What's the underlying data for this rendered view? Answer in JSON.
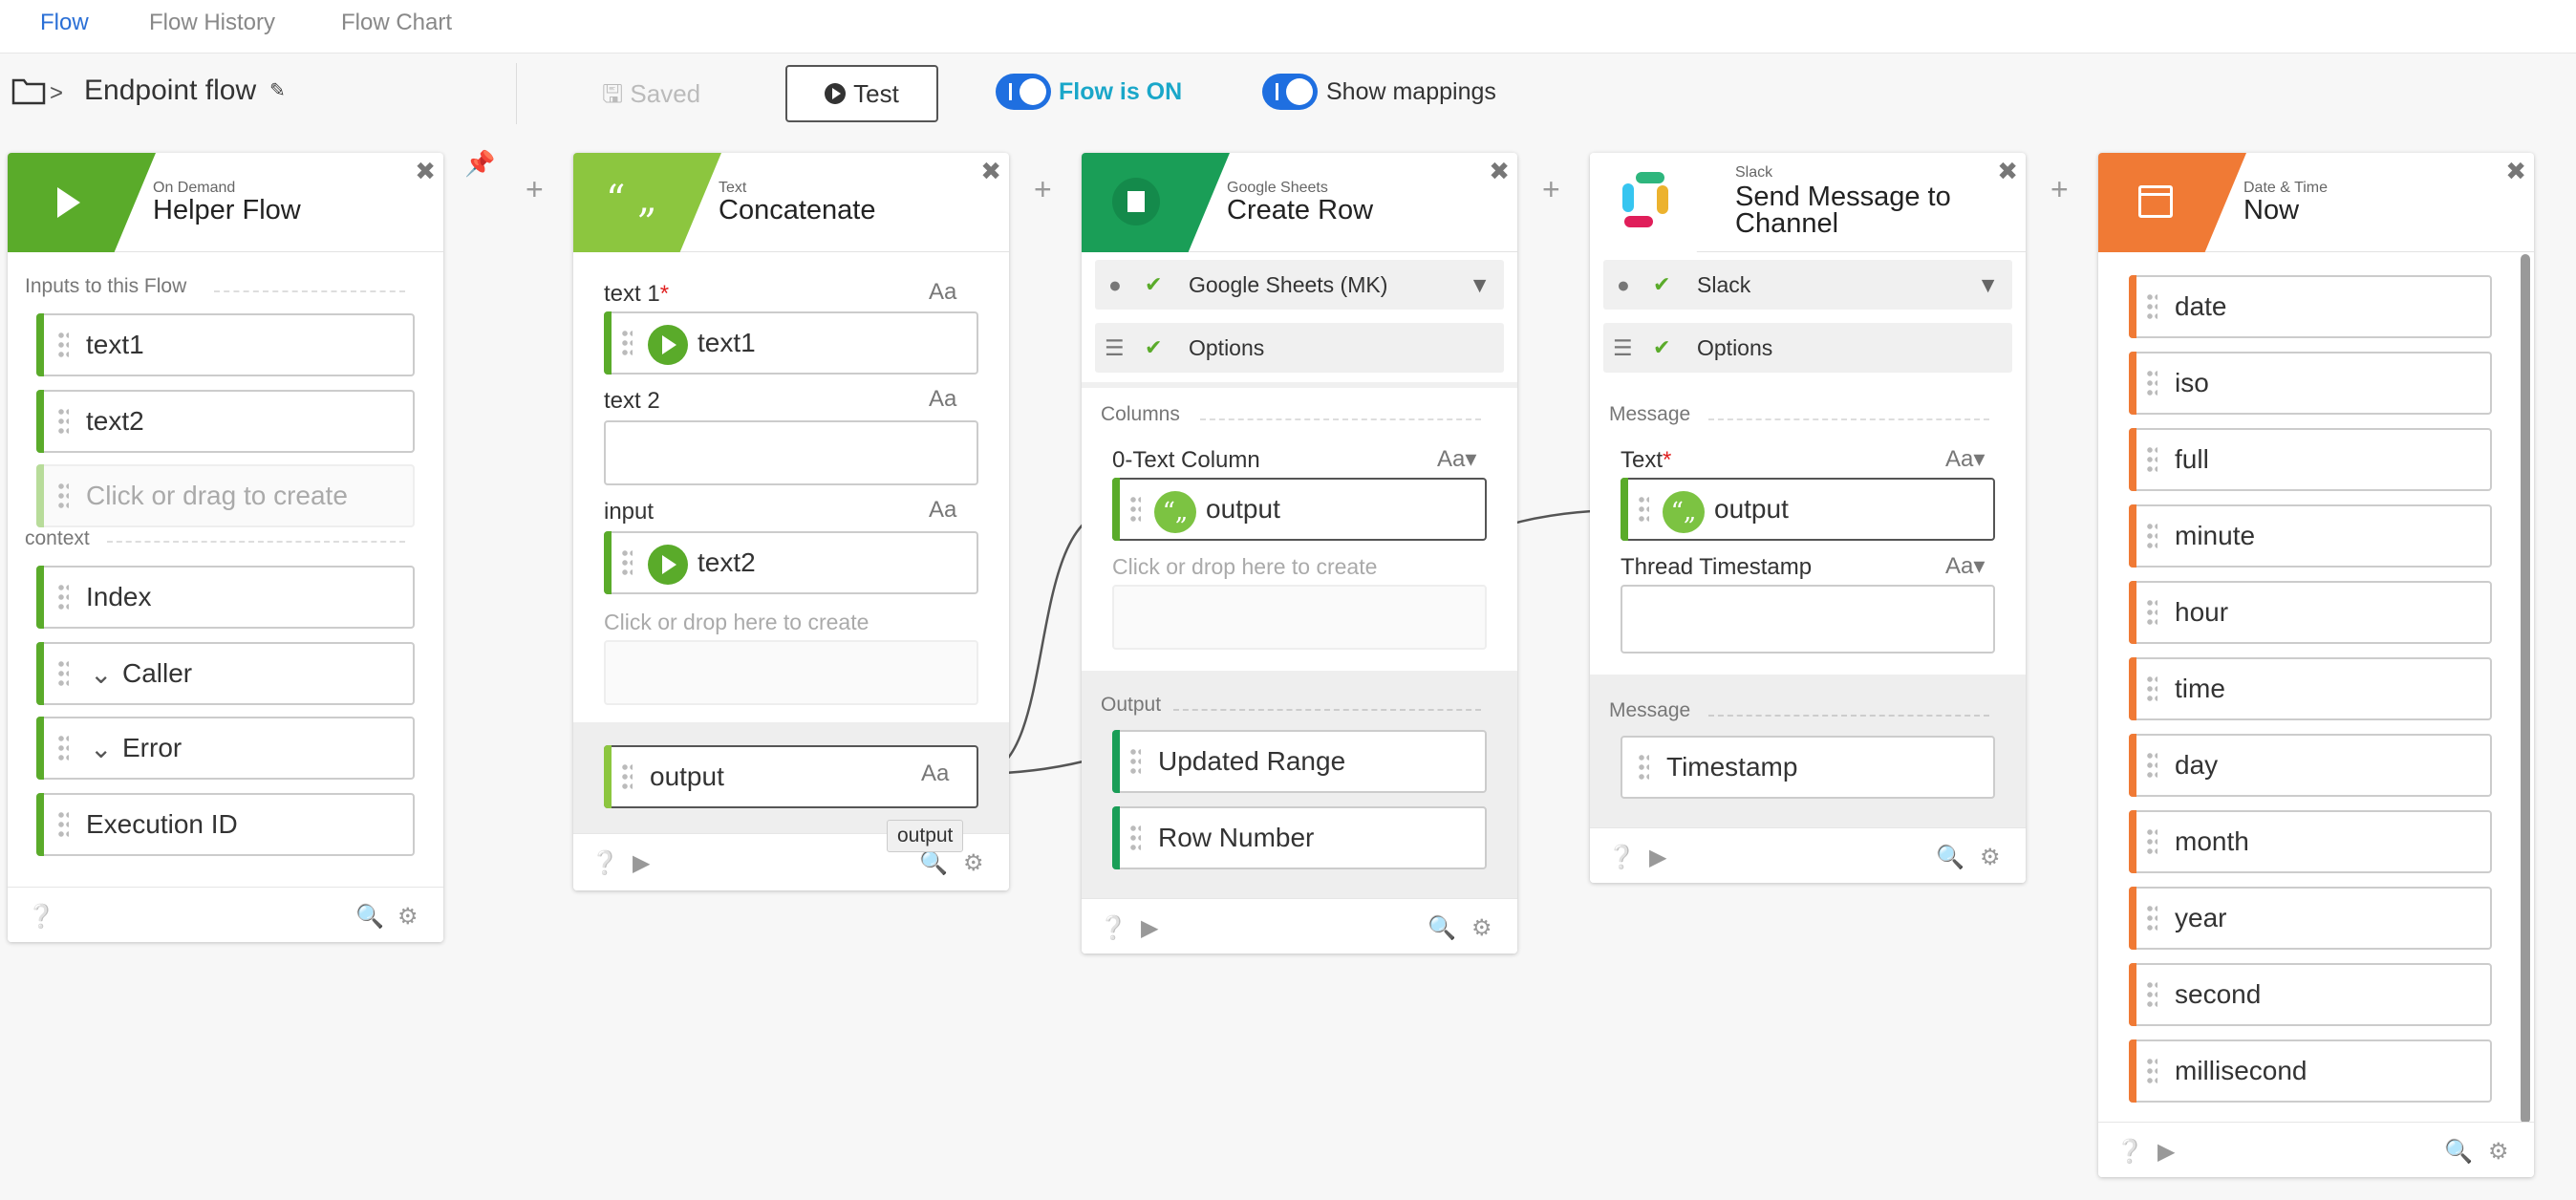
{
  "tabs": [
    {
      "label": "Flow"
    },
    {
      "label": "Flow History"
    },
    {
      "label": "Flow Chart"
    }
  ],
  "toolbar": {
    "flow_title": "Endpoint flow",
    "saved_label": "Saved",
    "test_label": "Test",
    "flow_on_label": "Flow is ON",
    "show_mappings_label": "Show mappings"
  },
  "colors": {
    "accent": "#1f6fe0",
    "flow_on": "#1aa7c9",
    "green": "#5aab2a",
    "light_green": "#8cc63f",
    "sheets_green": "#1a9e57",
    "orange": "#f07a35"
  },
  "cards": {
    "helper": {
      "subtitle": "On Demand",
      "title": "Helper Flow",
      "inputs_label": "Inputs to this Flow",
      "inputs": [
        "text1",
        "text2"
      ],
      "create_hint": "Click or drag to create",
      "context_label": "context",
      "context": [
        "Index",
        "Caller",
        "Error",
        "Execution ID"
      ]
    },
    "concat": {
      "subtitle": "Text",
      "title": "Concatenate",
      "field1_label": "text 1",
      "field1_value": "text1",
      "field2_label": "text 2",
      "field3_label": "input",
      "field3_value": "text2",
      "drop_hint": "Click or drop here to create",
      "output": "output",
      "tooltip": "output",
      "aa": "Aa"
    },
    "sheets": {
      "subtitle": "Google Sheets",
      "title": "Create Row",
      "connection": "Google Sheets (MK)",
      "options": "Options",
      "columns_label": "Columns",
      "column_label": "0-Text Column",
      "column_value": "output",
      "drop_hint": "Click or drop here to create",
      "output_label": "Output",
      "outputs": [
        "Updated Range",
        "Row Number"
      ]
    },
    "slack": {
      "subtitle": "Slack",
      "title_line1": "Send Message to",
      "title_line2": "Channel",
      "connection": "Slack",
      "options": "Options",
      "message_label": "Message",
      "text_label": "Text",
      "text_value": "output",
      "thread_label": "Thread Timestamp",
      "output_label": "Message",
      "outputs": [
        "Timestamp"
      ]
    },
    "datetime": {
      "subtitle": "Date & Time",
      "title": "Now",
      "outputs": [
        "date",
        "iso",
        "full",
        "minute",
        "hour",
        "time",
        "day",
        "month",
        "year",
        "second",
        "millisecond"
      ]
    }
  }
}
